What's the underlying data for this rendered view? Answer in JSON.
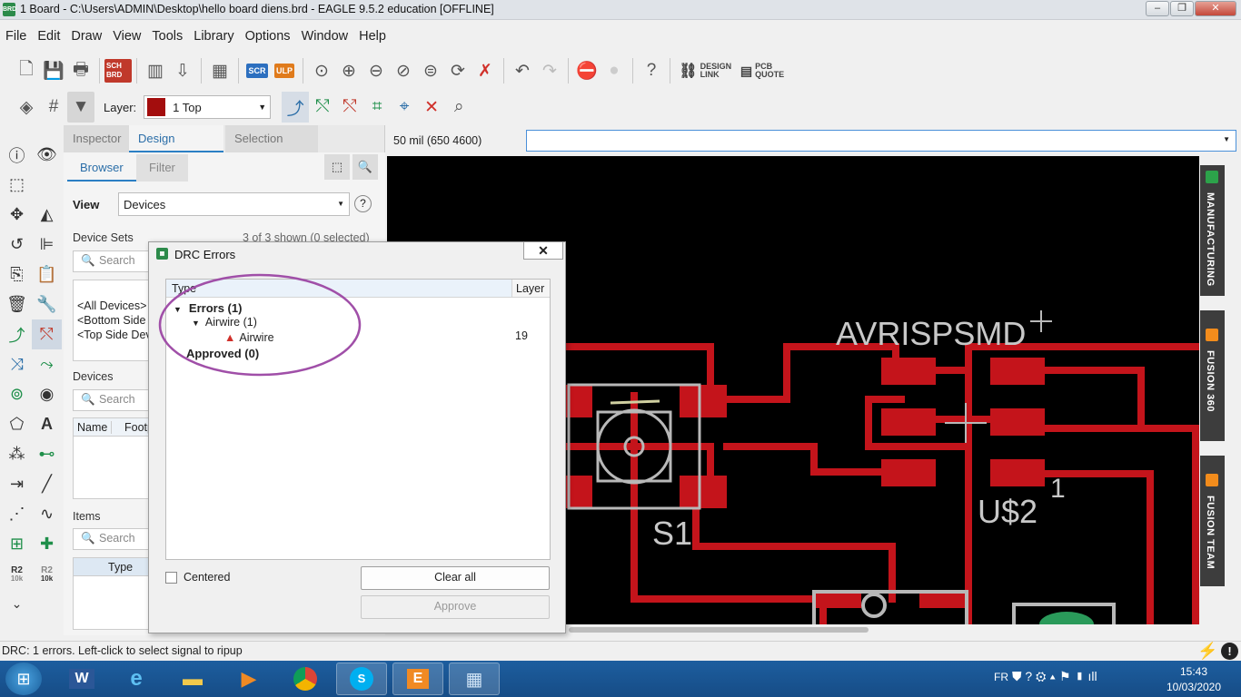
{
  "window": {
    "title": "1 Board - C:\\Users\\ADMIN\\Desktop\\hello board diens.brd - EAGLE 9.5.2 education [OFFLINE]",
    "icon_text": "BRD"
  },
  "menu": [
    "File",
    "Edit",
    "Draw",
    "View",
    "Tools",
    "Library",
    "Options",
    "Window",
    "Help"
  ],
  "toolbar": {
    "sch_brd": "SCH BRD",
    "scr": "SCR",
    "ulp": "ULP",
    "design_link": "DESIGN LINK",
    "pcb_quote": "PCB QUOTE",
    "layer_label": "Layer:",
    "layer_value": "1 Top",
    "layer_color": "#a30d0d"
  },
  "left_tools": {
    "r2_label": "R2",
    "r2_sub": "10k"
  },
  "panel": {
    "tabs": [
      "Inspector",
      "Design Manager",
      "Selection Filter"
    ],
    "subtabs": [
      "Browser",
      "Filter"
    ],
    "view_label": "View",
    "view_value": "Devices",
    "device_sets_label": "Device Sets",
    "device_sets_count": "3 of 3 shown (0 selected)",
    "search_placeholder": "Search",
    "device_sets": [
      "<All Devices>",
      "<Bottom Side Devices>",
      "<Top Side Devices>"
    ],
    "devices_label": "Devices",
    "devices_columns": [
      "Name",
      "Footprint"
    ],
    "items_label": "Items",
    "items_column": "Type"
  },
  "coord": {
    "readout": "50 mil (650 4600)"
  },
  "right_tabs": [
    "MANUFACTURING",
    "FUSION 360",
    "FUSION TEAM"
  ],
  "drc": {
    "title": "DRC Errors",
    "col_type": "Type",
    "col_layer": "Layer",
    "errors": "Errors (1)",
    "airwire_group": "Airwire (1)",
    "airwire_item": "Airwire",
    "airwire_layer": "19",
    "approved": "Approved (0)",
    "centered_label": "Centered",
    "clear_all": "Clear all",
    "approve": "Approve"
  },
  "board": {
    "label_avr": "AVRISPSMD",
    "label_us2": "U$2",
    "label_s1": "S1",
    "label_pin1": "1",
    "copper_color": "#c4141b"
  },
  "status": {
    "message": "DRC: 1 errors. Left-click to select signal to ripup"
  },
  "taskbar": {
    "lang": "FR",
    "time": "15:43",
    "date": "10/03/2020"
  }
}
